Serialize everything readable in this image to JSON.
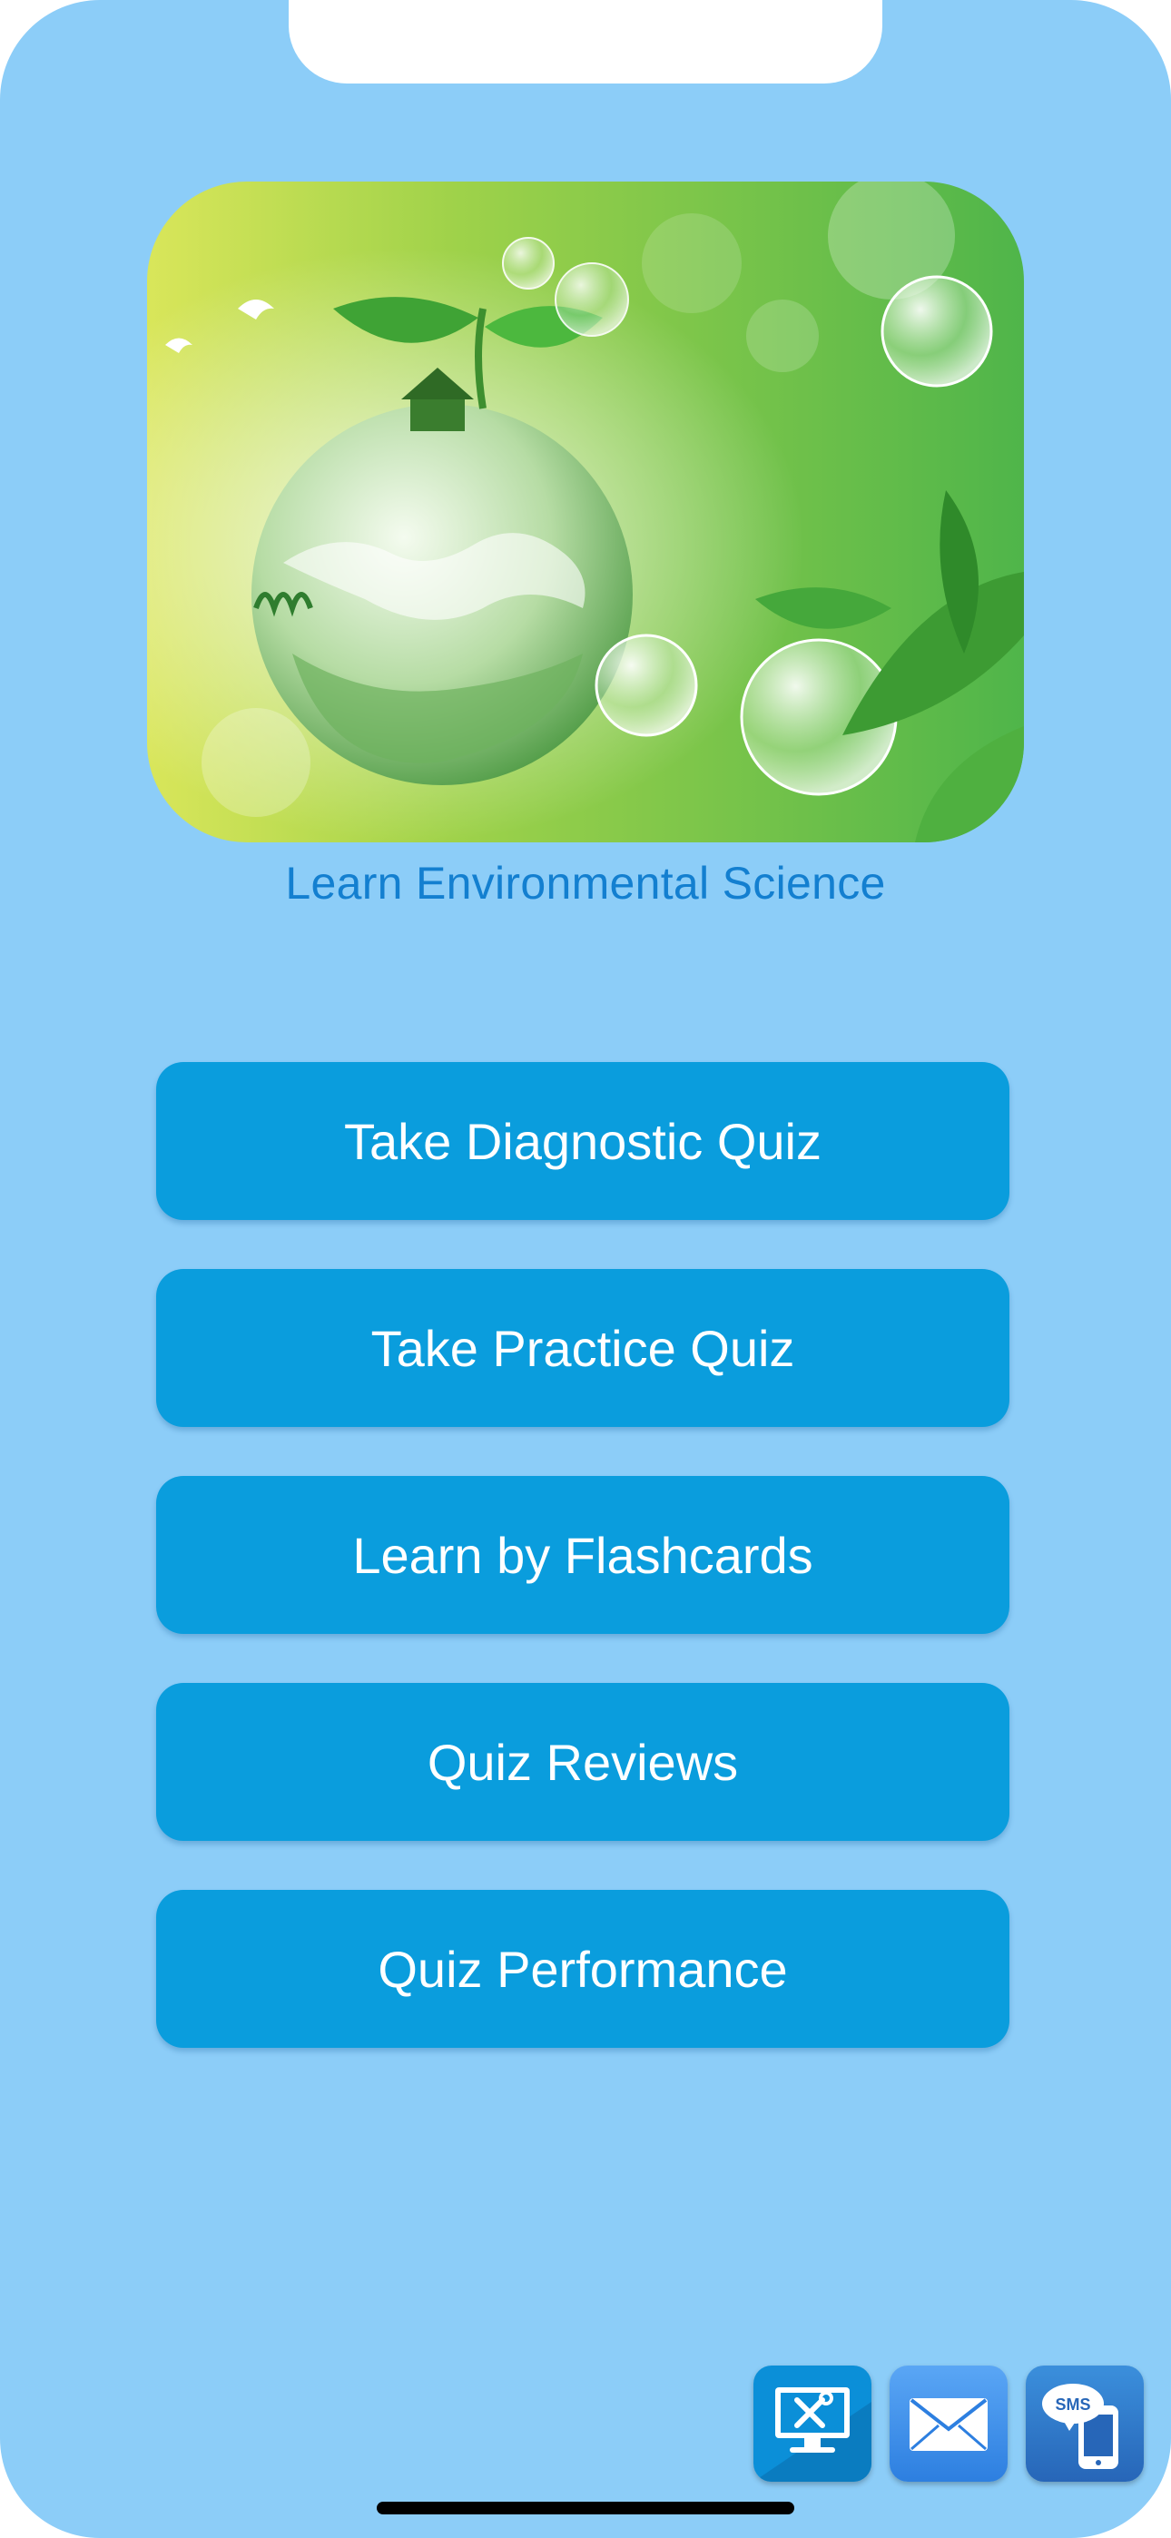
{
  "app": {
    "title": "Learn Environmental Science"
  },
  "hero": {
    "image_label": "environment-globe-illustration"
  },
  "menu": {
    "items": [
      {
        "label": "Take Diagnostic Quiz"
      },
      {
        "label": "Take Practice Quiz"
      },
      {
        "label": "Learn by Flashcards"
      },
      {
        "label": "Quiz Reviews"
      },
      {
        "label": "Quiz Performance"
      }
    ]
  },
  "footer": {
    "icons": [
      {
        "name": "support-tools-icon"
      },
      {
        "name": "email-icon"
      },
      {
        "name": "sms-icon",
        "text": "SMS"
      }
    ]
  },
  "colors": {
    "background": "#8ccdf8",
    "button": "#0a9ddd",
    "title": "#137fd0",
    "button_text": "#ffffff"
  }
}
